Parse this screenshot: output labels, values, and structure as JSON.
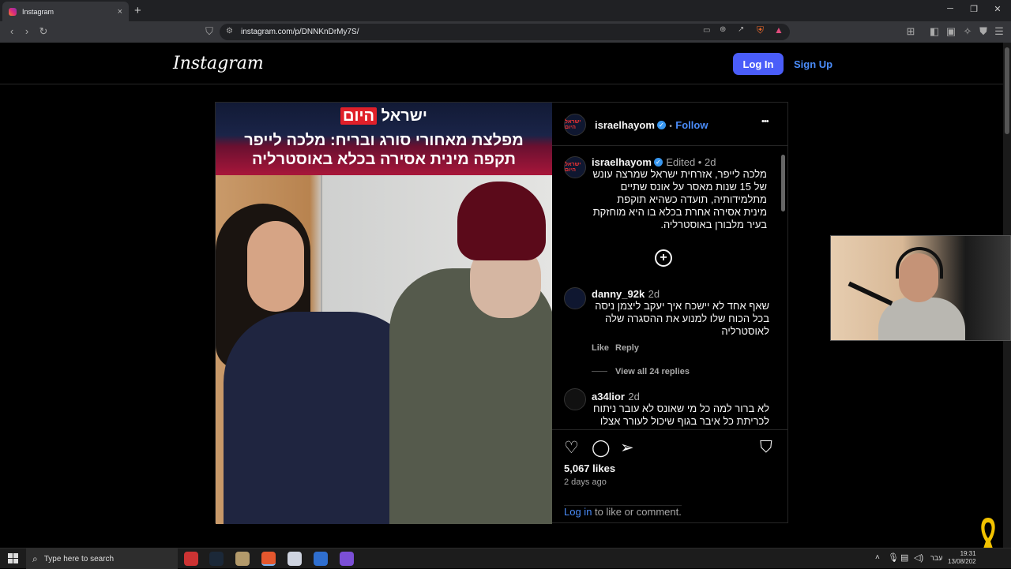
{
  "browser": {
    "tab_title": "Instagram",
    "url": "instagram.com/p/DNNKnDrMy7S/",
    "new_tab": "+",
    "tab_close": "×"
  },
  "instagram": {
    "logo": "Instagram",
    "login_label": "Log In",
    "signup_label": "Sign Up"
  },
  "post": {
    "image_brand_prefix": "ישראל",
    "image_brand_highlight": "היום",
    "image_headline_1": "מפלצת מאחורי סורג ובריח: מלכה לייפר",
    "image_headline_2": "תקפה מינית אסירה בכלא באוסטרליה",
    "author": "israelhayom",
    "follow_label": "Follow",
    "follow_dot": "•",
    "more": "•••",
    "avatar_text": "ישראל היום",
    "caption_meta": "Edited • 2d",
    "caption": "מלכה לייפר, אזרחית ישראל שמרצה עונש של 15 שנות מאסר על אונס שתיים מתלמידותיה, תועדה כשהיא תוקפת מינית אסירה אחרת בכלא בו היא מוחזקת בעיר מלבורן באוסטרליה.",
    "load_more": "+",
    "comments": [
      {
        "user": "danny_92k",
        "age": "2d",
        "text": "שאף אחד לא יישכח איך יעקב ליצמן ניסה בכל הכוח שלו למנוע את ההסגרה שלה לאוסטרליה",
        "like": "Like",
        "reply": "Reply",
        "replies": "View all 24 replies"
      },
      {
        "user": "a34lior",
        "age": "2d",
        "text": "לא ברור למה כל מי שאונס לא עובר ניתוח לכריתת כל איבר בגוף שיכול לעורר אצלו"
      }
    ],
    "likes": "5,067 likes",
    "ago": "2 days ago",
    "login_link": "Log in",
    "login_rest": " to like or comment."
  },
  "taskbar": {
    "search_placeholder": "Type here to search",
    "lang": "עבר",
    "time": "19:31",
    "date": "13/08/202"
  }
}
